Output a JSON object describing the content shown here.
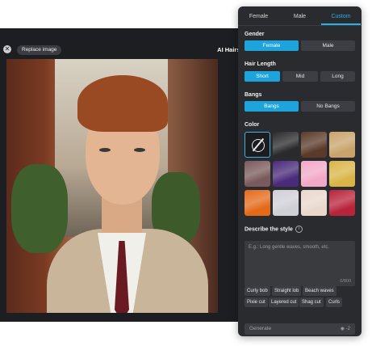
{
  "editor": {
    "close_icon": "close-icon",
    "replace_label": "Replace image",
    "title": "AI Hairst"
  },
  "panel": {
    "tabs": [
      {
        "label": "Female"
      },
      {
        "label": "Male"
      },
      {
        "label": "Custom",
        "active": true
      }
    ],
    "gender": {
      "label": "Gender",
      "options": [
        "Female",
        "Male"
      ],
      "selected": "Female"
    },
    "hair_length": {
      "label": "Hair Length",
      "options": [
        "Short",
        "Mid",
        "Long"
      ],
      "selected": "Short"
    },
    "bangs": {
      "label": "Bangs",
      "options": [
        "Bangs",
        "No Bangs"
      ],
      "selected": "Bangs"
    },
    "color": {
      "label": "Color",
      "swatches": [
        {
          "name": "none",
          "color": "#1b1c1f",
          "selected": true
        },
        {
          "name": "black",
          "color": "#2a2a2c"
        },
        {
          "name": "dark-brown",
          "color": "#5b3a2a"
        },
        {
          "name": "blonde",
          "color": "#c9a36b"
        },
        {
          "name": "mauve-brown",
          "color": "#7a5a5c"
        },
        {
          "name": "purple",
          "color": "#4a2a7a"
        },
        {
          "name": "pink",
          "color": "#f2a8c8"
        },
        {
          "name": "golden",
          "color": "#d9b548"
        },
        {
          "name": "orange",
          "color": "#e46a1a"
        },
        {
          "name": "silver",
          "color": "#cfcfd6"
        },
        {
          "name": "light-beige",
          "color": "#e9d7cc"
        },
        {
          "name": "red",
          "color": "#b8243a"
        }
      ]
    },
    "describe": {
      "label": "Describe the style",
      "info_icon": "info-icon",
      "placeholder": "E.g.: Long gentle waves, smooth, etc.",
      "counter": "0/800"
    },
    "chips": [
      "Curly bob",
      "Straight lob",
      "Beach waves",
      "Pixie cut",
      "Layered cut",
      "Shag cut",
      "Curls"
    ],
    "generate": {
      "label": "Generate",
      "cost": "-2",
      "coin_icon": "coin-icon"
    }
  }
}
